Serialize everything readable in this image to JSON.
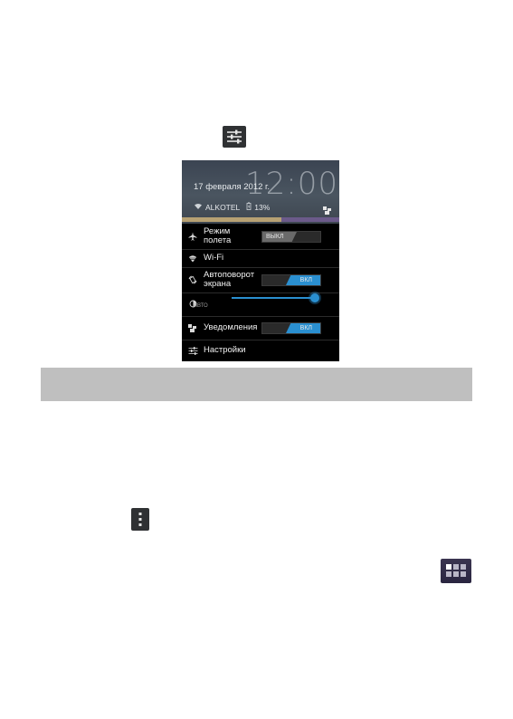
{
  "status": {
    "time": "12:00",
    "date": "17 февраля 2012 г.",
    "network": "ALKOTEL",
    "battery": "13%"
  },
  "quick_settings": {
    "airplane": {
      "label_line1": "Режим",
      "label_line2": "полета",
      "toggle": "ВЫКЛ",
      "state": "off"
    },
    "wifi": {
      "label": "Wi-Fi"
    },
    "autorotate": {
      "label_line1": "Автоповорот",
      "label_line2": "экрана",
      "toggle": "ВКЛ",
      "state": "on"
    },
    "brightness": {
      "auto_label": "АВТО",
      "level": 0.95
    },
    "notifications": {
      "label": "Уведомления",
      "toggle": "ВКЛ",
      "state": "on"
    },
    "settings": {
      "label": "Настройки"
    }
  },
  "colors": {
    "accent_blue": "#2a8fd0",
    "page_bar": "#bfbfbf",
    "panel_bg": "#000000"
  },
  "icons": {
    "top": "settings-sliders-icon",
    "middle": "overflow-menu-icon",
    "bottom": "all-apps-icon"
  }
}
